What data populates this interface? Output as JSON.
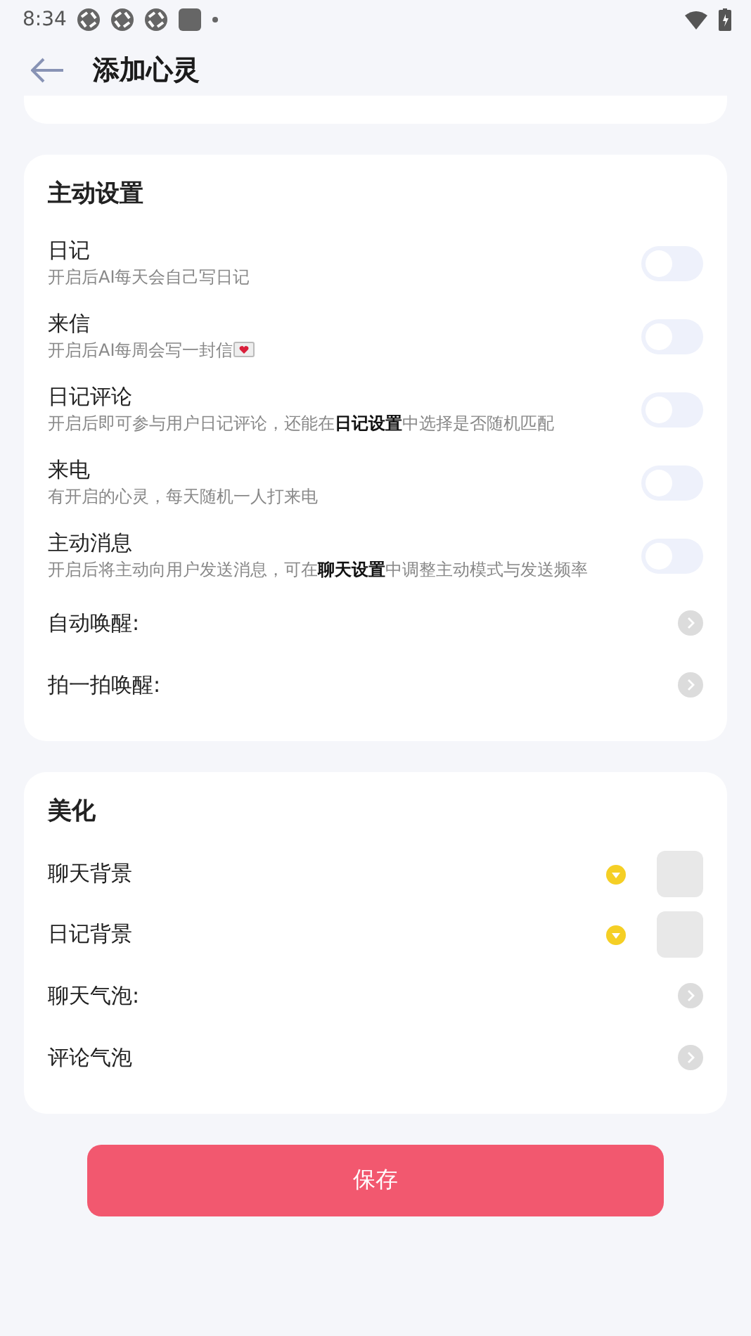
{
  "status_bar": {
    "time": "8:34"
  },
  "header": {
    "title": "添加心灵"
  },
  "sections": [
    {
      "title": "主动设置",
      "rows": [
        {
          "kind": "switch",
          "label": "日记",
          "description": "开启后AI每天会自己写日记",
          "on": false
        },
        {
          "kind": "switch",
          "label": "来信",
          "description": "开启后AI每周会写一封信",
          "letter_icon": true,
          "on": false
        },
        {
          "kind": "switch",
          "label": "日记评论",
          "description": "开启后即可参与用户日记评论，还能在**日记设置**中选择是否随机匹配",
          "on": false
        },
        {
          "kind": "switch",
          "label": "来电",
          "description": "有开启的心灵，每天随机一人打来电",
          "on": false
        },
        {
          "kind": "switch",
          "label": "主动消息",
          "description": "开启后将主动向用户发送消息，可在**聊天设置**中调整主动模式与发送频率",
          "on": false
        },
        {
          "kind": "link",
          "label": "自动唤醒:"
        },
        {
          "kind": "link",
          "label": "拍一拍唤醒:"
        }
      ]
    },
    {
      "title": "美化",
      "rows": [
        {
          "kind": "image",
          "label": "聊天背景"
        },
        {
          "kind": "image",
          "label": "日记背景"
        },
        {
          "kind": "link",
          "label": "聊天气泡:"
        },
        {
          "kind": "link",
          "label": "评论气泡"
        }
      ]
    }
  ],
  "save_button": {
    "label": "保存"
  }
}
